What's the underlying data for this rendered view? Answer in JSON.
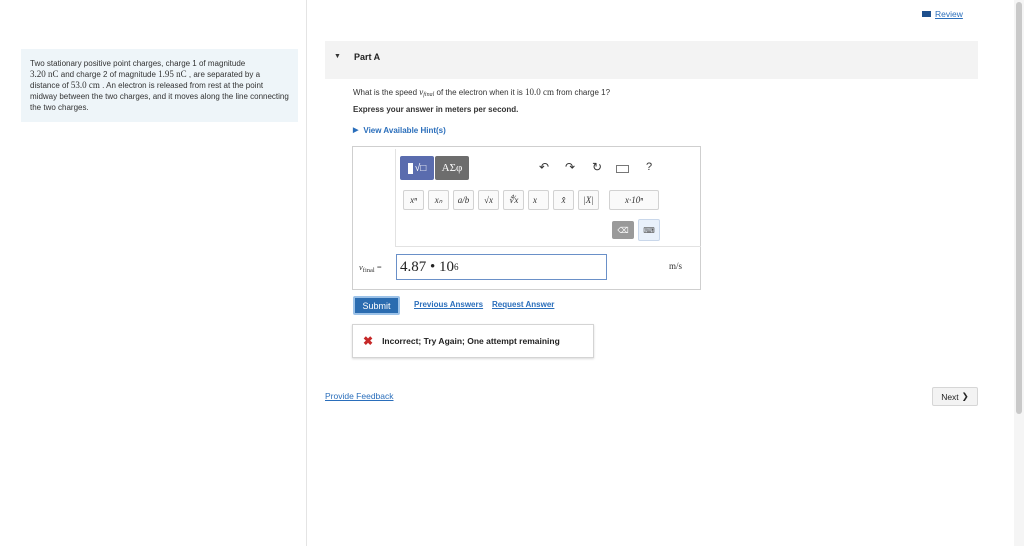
{
  "header": {
    "review_label": "Review"
  },
  "problem": {
    "p1": "Two stationary positive point charges, charge 1 of magnitude",
    "q1_value": "3.20 nC",
    "p2": " and charge 2 of magnitude ",
    "q2_value": "1.95 nC",
    "p3": " , are separated by a distance of ",
    "dist_value": "53.0 cm",
    "p4": " . An electron is released from rest at the point midway between the two charges, and it moves along the line connecting the two charges."
  },
  "part": {
    "title": "Part A",
    "question_pre": "What is the speed ",
    "question_var": "v",
    "question_sub": "final",
    "question_mid": " of the electron when it is ",
    "question_dist": "10.0 cm",
    "question_post": " from charge 1?",
    "instruction": "Express your answer in meters per second.",
    "hints_label": "View Available Hint(s)"
  },
  "toolbar": {
    "templates_label": "√□",
    "greek_label": "ΑΣφ",
    "undo": "↶",
    "redo": "↷",
    "reset": "↻",
    "help": "?",
    "symbols": [
      "xⁿ",
      "xₙ",
      "a/b",
      "√x",
      "∜x",
      "x⃗",
      "x̂",
      "|X|",
      "x·10ⁿ"
    ],
    "delete_label": "⌫",
    "keyboard_label": "⌨"
  },
  "answer": {
    "var": "v",
    "var_sub": "final",
    "equals": " =",
    "value": "4.87 • 10",
    "exponent": "6",
    "unit": "m/s"
  },
  "actions": {
    "submit": "Submit",
    "previous_answers": "Previous Answers",
    "request_answer": "Request Answer"
  },
  "feedback": {
    "message": "Incorrect; Try Again; One attempt remaining"
  },
  "footer": {
    "provide_feedback": "Provide Feedback",
    "next": "Next"
  }
}
